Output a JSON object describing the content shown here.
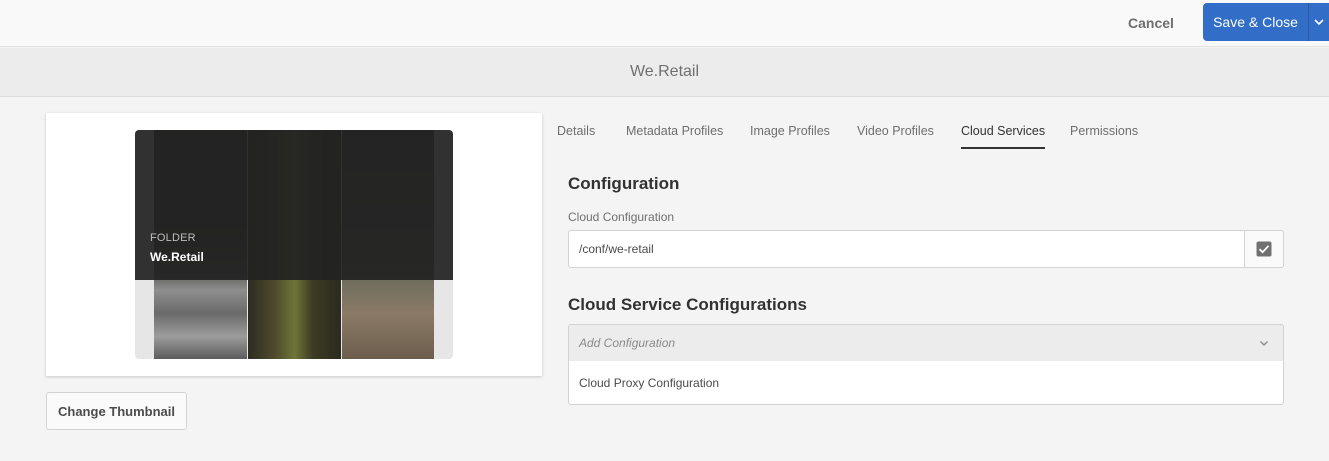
{
  "toolbar": {
    "cancel_label": "Cancel",
    "save_label": "Save & Close"
  },
  "header": {
    "title": "We.Retail"
  },
  "thumbnail": {
    "type_label": "FOLDER",
    "name": "We.Retail",
    "change_button_label": "Change Thumbnail"
  },
  "tabs": [
    {
      "label": "Details",
      "active": false
    },
    {
      "label": "Metadata Profiles",
      "active": false
    },
    {
      "label": "Image Profiles",
      "active": false
    },
    {
      "label": "Video Profiles",
      "active": false
    },
    {
      "label": "Cloud Services",
      "active": true
    },
    {
      "label": "Permissions",
      "active": false
    }
  ],
  "configuration": {
    "heading": "Configuration",
    "field_label": "Cloud Configuration",
    "value": "/conf/we-retail"
  },
  "cloud_services": {
    "heading": "Cloud Service Configurations",
    "placeholder": "Add Configuration",
    "options": [
      "Cloud Proxy Configuration"
    ]
  },
  "colors": {
    "accent": "#326ec8",
    "background": "#f4f4f4"
  }
}
